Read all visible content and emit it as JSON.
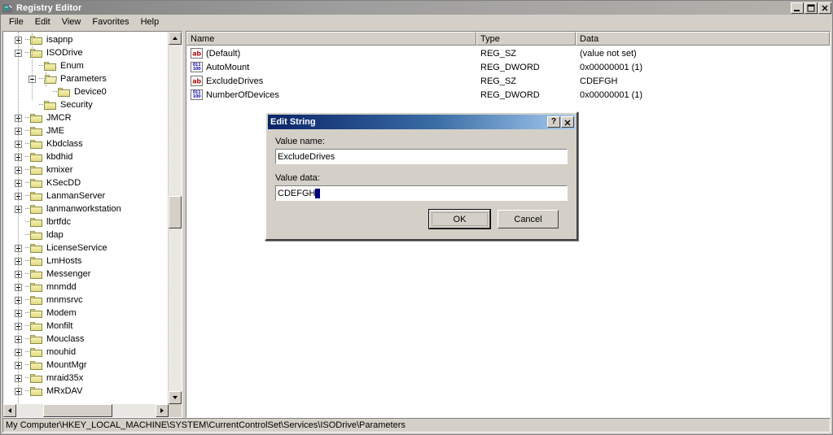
{
  "window": {
    "title": "Registry Editor",
    "icon": "registry-editor-icon",
    "caption_buttons": [
      {
        "name": "minimize",
        "glyph": "_"
      },
      {
        "name": "maximize",
        "glyph": "□"
      },
      {
        "name": "close",
        "glyph": "✕"
      }
    ]
  },
  "menu": {
    "items": [
      "File",
      "Edit",
      "View",
      "Favorites",
      "Help"
    ]
  },
  "tree": {
    "nodes": [
      {
        "label": "isapnp",
        "depth": 1,
        "expander": "plus",
        "icon": "folder-closed-icon"
      },
      {
        "label": "ISODrive",
        "depth": 1,
        "expander": "minus",
        "icon": "folder-closed-icon"
      },
      {
        "label": "Enum",
        "depth": 2,
        "expander": "none",
        "icon": "folder-closed-icon"
      },
      {
        "label": "Parameters",
        "depth": 2,
        "expander": "minus",
        "icon": "folder-open-icon"
      },
      {
        "label": "Device0",
        "depth": 3,
        "expander": "none",
        "icon": "folder-closed-icon"
      },
      {
        "label": "Security",
        "depth": 2,
        "expander": "none",
        "icon": "folder-closed-icon"
      },
      {
        "label": "JMCR",
        "depth": 1,
        "expander": "plus",
        "icon": "folder-closed-icon"
      },
      {
        "label": "JME",
        "depth": 1,
        "expander": "plus",
        "icon": "folder-closed-icon"
      },
      {
        "label": "Kbdclass",
        "depth": 1,
        "expander": "plus",
        "icon": "folder-closed-icon"
      },
      {
        "label": "kbdhid",
        "depth": 1,
        "expander": "plus",
        "icon": "folder-closed-icon"
      },
      {
        "label": "kmixer",
        "depth": 1,
        "expander": "plus",
        "icon": "folder-closed-icon"
      },
      {
        "label": "KSecDD",
        "depth": 1,
        "expander": "plus",
        "icon": "folder-closed-icon"
      },
      {
        "label": "LanmanServer",
        "depth": 1,
        "expander": "plus",
        "icon": "folder-closed-icon"
      },
      {
        "label": "lanmanworkstation",
        "depth": 1,
        "expander": "plus",
        "icon": "folder-closed-icon"
      },
      {
        "label": "lbrtfdc",
        "depth": 1,
        "expander": "none",
        "icon": "folder-closed-icon"
      },
      {
        "label": "ldap",
        "depth": 1,
        "expander": "none",
        "icon": "folder-closed-icon"
      },
      {
        "label": "LicenseService",
        "depth": 1,
        "expander": "plus",
        "icon": "folder-closed-icon"
      },
      {
        "label": "LmHosts",
        "depth": 1,
        "expander": "plus",
        "icon": "folder-closed-icon"
      },
      {
        "label": "Messenger",
        "depth": 1,
        "expander": "plus",
        "icon": "folder-closed-icon"
      },
      {
        "label": "mnmdd",
        "depth": 1,
        "expander": "plus",
        "icon": "folder-closed-icon"
      },
      {
        "label": "mnmsrvc",
        "depth": 1,
        "expander": "plus",
        "icon": "folder-closed-icon"
      },
      {
        "label": "Modem",
        "depth": 1,
        "expander": "plus",
        "icon": "folder-closed-icon"
      },
      {
        "label": "Monfilt",
        "depth": 1,
        "expander": "plus",
        "icon": "folder-closed-icon"
      },
      {
        "label": "Mouclass",
        "depth": 1,
        "expander": "plus",
        "icon": "folder-closed-icon"
      },
      {
        "label": "mouhid",
        "depth": 1,
        "expander": "plus",
        "icon": "folder-closed-icon"
      },
      {
        "label": "MountMgr",
        "depth": 1,
        "expander": "plus",
        "icon": "folder-closed-icon"
      },
      {
        "label": "mraid35x",
        "depth": 1,
        "expander": "plus",
        "icon": "folder-closed-icon"
      },
      {
        "label": "MRxDAV",
        "depth": 1,
        "expander": "plus",
        "icon": "folder-closed-icon"
      }
    ]
  },
  "list": {
    "columns": [
      "Name",
      "Type",
      "Data"
    ],
    "rows": [
      {
        "name": "(Default)",
        "type": "REG_SZ",
        "data": "(value not set)",
        "icon": "string-value-icon"
      },
      {
        "name": "AutoMount",
        "type": "REG_DWORD",
        "data": "0x00000001 (1)",
        "icon": "dword-value-icon"
      },
      {
        "name": "ExcludeDrives",
        "type": "REG_SZ",
        "data": "CDEFGH",
        "icon": "string-value-icon"
      },
      {
        "name": "NumberOfDevices",
        "type": "REG_DWORD",
        "data": "0x00000001 (1)",
        "icon": "dword-value-icon"
      }
    ]
  },
  "status": {
    "path": "My Computer\\HKEY_LOCAL_MACHINE\\SYSTEM\\CurrentControlSet\\Services\\ISODrive\\Parameters"
  },
  "dialog": {
    "title": "Edit String",
    "help_glyph": "?",
    "close_glyph": "✕",
    "value_name_label": "Value name:",
    "value_name": "ExcludeDrives",
    "value_data_label": "Value data:",
    "value_data": "CDEFGH",
    "ok_label": "OK",
    "cancel_label": "Cancel"
  },
  "colors": {
    "face": "#d4d0c8",
    "active_title_start": "#0a246a",
    "active_title_end": "#a6caf0",
    "inactive_title_start": "#808080",
    "inactive_title_end": "#b5b2ac",
    "string_icon": "#b01010",
    "dword_icon": "#1515b0",
    "caret": "#000080"
  }
}
